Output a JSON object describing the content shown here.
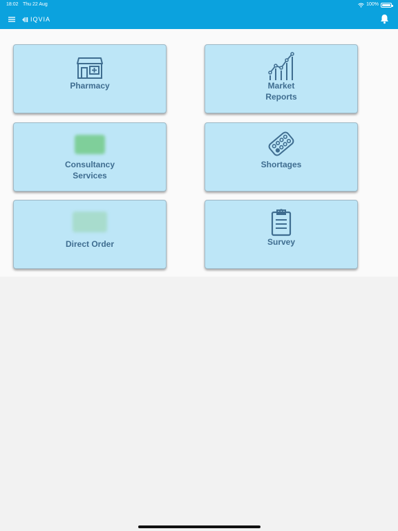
{
  "status_bar": {
    "time": "18:02",
    "date": "Thu 22 Aug",
    "battery": "100%"
  },
  "header": {
    "logo_text": "IQVIA",
    "menu_icon": "hamburger-menu-icon",
    "bell_icon": "bell-icon",
    "background": "#0ba2de"
  },
  "tiles": [
    {
      "line1": "Pharmacy",
      "line2": "",
      "icon": "pharmacy-store-icon"
    },
    {
      "line1": "Market",
      "line2": "Reports",
      "icon": "bar-chart-trend-icon"
    },
    {
      "line1": "Consultancy",
      "line2": "Services",
      "icon": "blurred-consultancy-icon"
    },
    {
      "line1": "Shortages",
      "line2": "",
      "icon": "pill-blister-icon"
    },
    {
      "line1": "Direct Order",
      "line2": "",
      "icon": "blurred-direct-order-icon"
    },
    {
      "line1": "Survey",
      "line2": "",
      "icon": "clipboard-icon"
    }
  ],
  "colors": {
    "tile_background": "#bde6f7",
    "tile_text": "#3f6d90",
    "page_background": "#f2f2f2"
  }
}
